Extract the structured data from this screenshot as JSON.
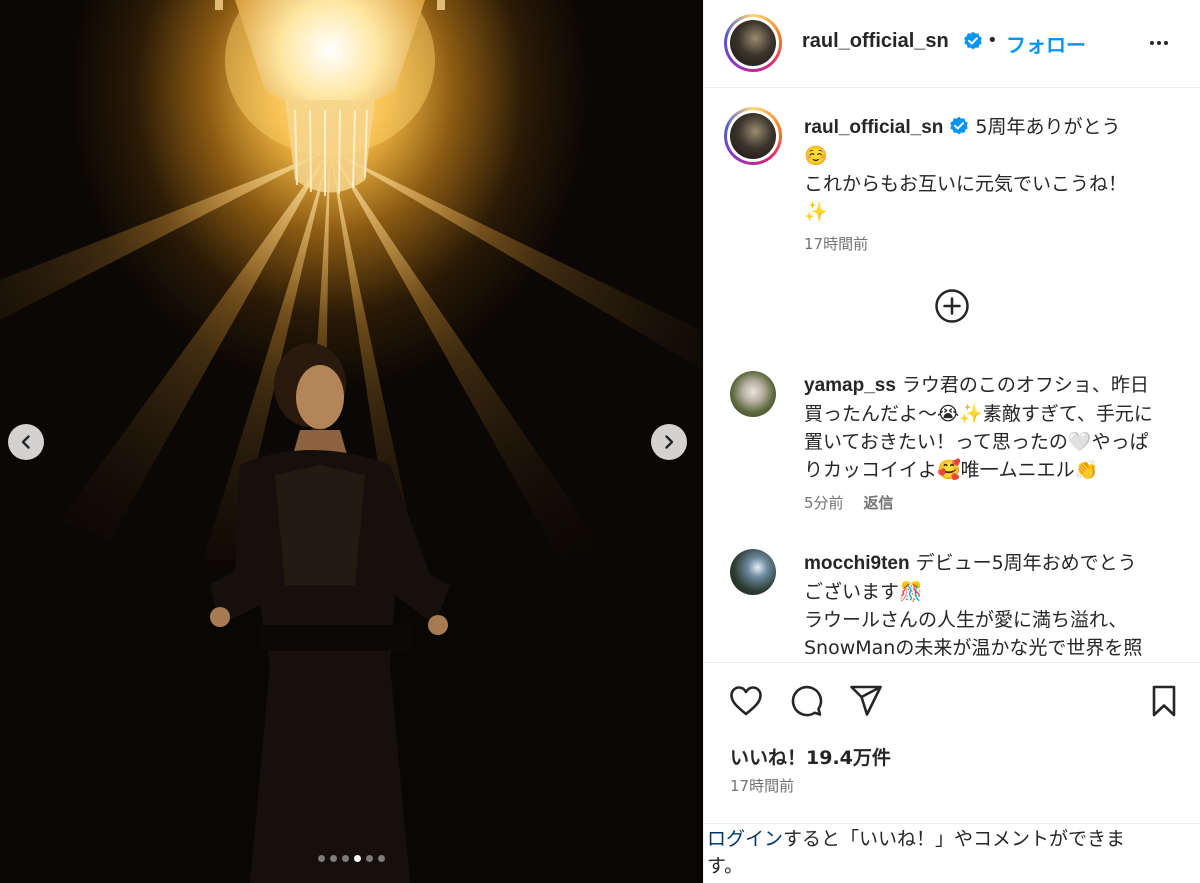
{
  "post": {
    "author": "raul_official_sn",
    "follow_label": "フォロー",
    "separator": "•",
    "carousel": {
      "total_images": 6,
      "active_index": 3
    }
  },
  "caption": {
    "username": "raul_official_sn",
    "lines": [
      "5周年ありがとう",
      "☺️",
      "これからもお互いに元気でいこうね！",
      "✨"
    ],
    "time": "17時間前"
  },
  "comments": [
    {
      "username": "yamap_ss",
      "text_first": "ラウ君のこのオフショ、昨日",
      "lines": [
        "買ったんだよ〜😭✨素敵すぎて、手元に",
        "置いておきたい！って思ったの🤍やっぱ",
        "りカッコイイよ🥰唯一ムニエル👏"
      ],
      "time": "5分前",
      "reply_label": "返信"
    },
    {
      "username": "mocchi9ten",
      "text_first": "デビュー5周年おめでとう",
      "lines": [
        "ございます🎊",
        "ラウールさんの人生が愛に満ち溢れ、",
        "SnowManの未来が温かな光で世界を照"
      ]
    }
  ],
  "actions": {
    "likes_label": "いいね！19.4万件",
    "posted_time": "17時間前"
  },
  "login_prompt": {
    "link": "ログイン",
    "rest_line1": "すると「いいね！」やコメントができま",
    "rest_line2": "す。"
  },
  "icons": {
    "like": "heart-icon",
    "comment": "comment-bubble-icon",
    "share": "paper-plane-icon",
    "save": "bookmark-icon",
    "more": "more-horizontal-icon",
    "verified": "verified-badge-icon",
    "load_more": "plus-circle-icon"
  },
  "colors": {
    "accent": "#0095f6",
    "verified": "#0095f6",
    "muted": "#737373",
    "link": "#00376b"
  }
}
